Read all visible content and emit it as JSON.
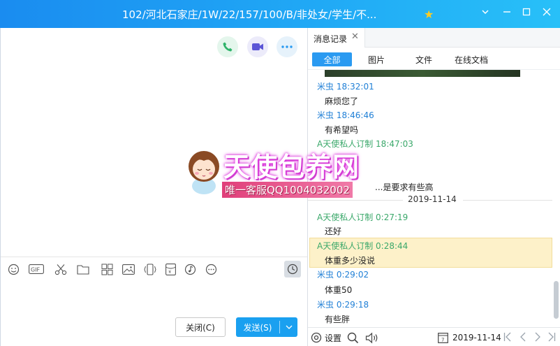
{
  "window": {
    "title": "102/河北石家庄/1W/22/157/100/B/非处女/学生/不...",
    "controls": [
      "chevron-down",
      "minimize",
      "maximize",
      "close"
    ]
  },
  "toolbar_icons": [
    "emoji-icon",
    "gif-icon",
    "scissors-icon",
    "folder-icon",
    "grid-icon",
    "image-icon",
    "phone-vibrate-icon",
    "red-packet-icon",
    "music-icon",
    "more-icon"
  ],
  "buttons": {
    "close": "关闭(C)",
    "send": "发送(S)"
  },
  "history": {
    "tab_title": "消息记录",
    "filters": [
      "全部",
      "图片",
      "文件",
      "在线文档"
    ],
    "active_filter": "全部",
    "date_separator": "2019-11-14",
    "messages": [
      {
        "sender": "米虫",
        "time": "18:32:01",
        "text": "麻烦您了",
        "self": true
      },
      {
        "sender": "米虫",
        "time": "18:46:46",
        "text": "有希望吗",
        "self": true
      },
      {
        "sender": "A天使私人订制",
        "time": "18:47:03",
        "text": "...是要求有些高",
        "self": false
      },
      {
        "sender": "A天使私人订制",
        "time": "0:27:19",
        "text": "还好",
        "self": false
      },
      {
        "sender": "A天使私人订制",
        "time": "0:28:44",
        "text": "体重多少没说",
        "self": false
      },
      {
        "sender": "米虫",
        "time": "0:29:02",
        "text": "体重50",
        "self": true
      },
      {
        "sender": "米虫",
        "time": "0:29:18",
        "text": "有些胖",
        "self": true
      }
    ],
    "footer": {
      "settings": "设置",
      "date": "2019-11-14"
    }
  },
  "watermark": {
    "brand": "天使包养网",
    "contact": "唯一客服QQ1004032002"
  },
  "colors": {
    "titlebar": "#1a8cf0",
    "accent": "#2a9af1",
    "self_name": "#1f7fd6",
    "other_name": "#3aa86a",
    "highlight": "#fdf1c9"
  }
}
